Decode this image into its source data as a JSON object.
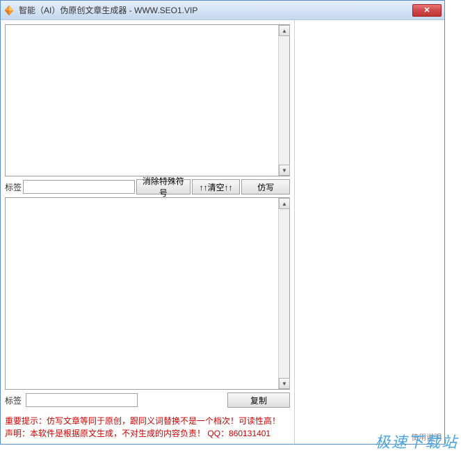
{
  "window": {
    "title": "智能（AI）伪原创文章生成器 - WWW.SEO1.VIP"
  },
  "labels": {
    "tag": "标签"
  },
  "buttons": {
    "remove_special": "消除特殊符号",
    "clear": "↑↑清空↑↑",
    "rewrite": "仿写",
    "copy": "复制"
  },
  "notice": {
    "line1": "重要提示：仿写文章等同于原创，跟同义词替换不是一个档次！可读性高！",
    "line2_prefix": "声明：本软件是根据原文生成，不对生成的内容负责！",
    "qq": "QQ：860131401"
  },
  "right_panel": {
    "usage": "使用说明"
  },
  "watermark": "极速下载站"
}
